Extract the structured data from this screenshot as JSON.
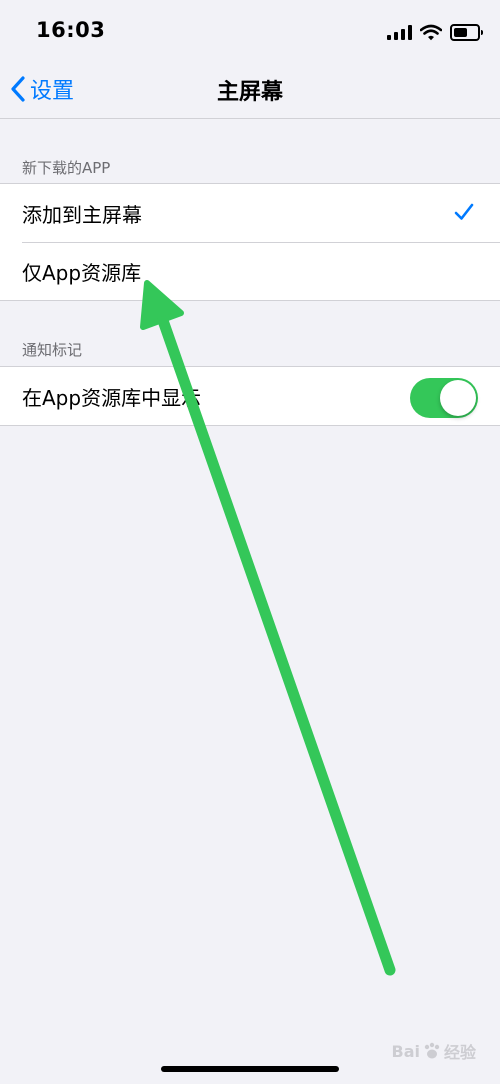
{
  "status_bar": {
    "time": "16:03"
  },
  "nav": {
    "back_label": "设置",
    "title": "主屏幕"
  },
  "sections": {
    "new_apps": {
      "header": "新下载的APP",
      "options": [
        {
          "label": "添加到主屏幕",
          "selected": true
        },
        {
          "label": "仅App资源库",
          "selected": false
        }
      ]
    },
    "badges": {
      "header": "通知标记",
      "toggle_row": {
        "label": "在App资源库中显示",
        "on": true
      }
    }
  },
  "watermark": {
    "brand_left": "Bai",
    "brand_right": "经验"
  },
  "icons": {
    "back": "chevron-left-icon",
    "check": "checkmark-icon",
    "signal": "signal-icon",
    "wifi": "wifi-icon",
    "battery": "battery-icon",
    "annotation": "arrow-icon"
  },
  "colors": {
    "accent": "#007aff",
    "toggle_on": "#34c759",
    "annotation_arrow": "#34c759",
    "background": "#f2f2f7"
  }
}
